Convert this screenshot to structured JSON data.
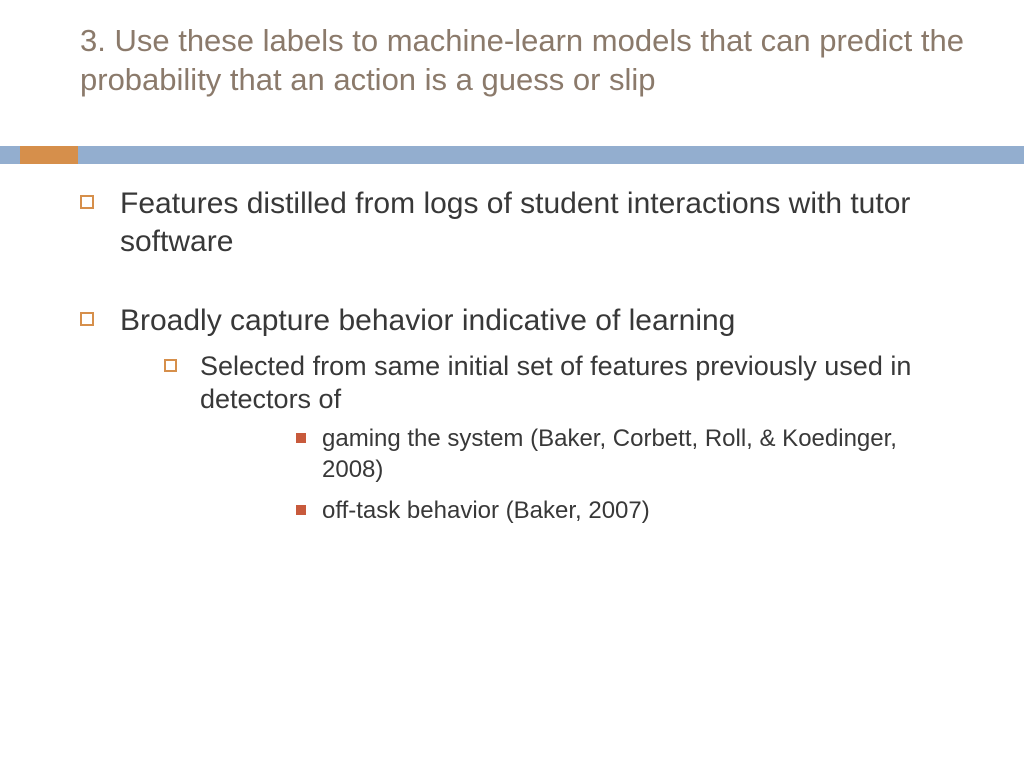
{
  "title": "3. Use these labels to machine-learn models that can predict the probability that an action is a guess or slip",
  "colors": {
    "title_text": "#8b7a6b",
    "divider_main": "#93aecf",
    "divider_accent": "#d68f4b",
    "bullet_outline": "#d68f4b",
    "bullet_fill": "#c85a3c"
  },
  "bullets": [
    {
      "text": "Features distilled from logs of student interactions with tutor software",
      "children": []
    },
    {
      "text": "Broadly capture behavior indicative of learning",
      "children": [
        {
          "text": "Selected from same initial set of features previously used in detectors of",
          "children": [
            {
              "text": "gaming the system (Baker, Corbett, Roll, & Koedinger, 2008)"
            },
            {
              "text": "off-task behavior (Baker, 2007)"
            }
          ]
        }
      ]
    }
  ]
}
